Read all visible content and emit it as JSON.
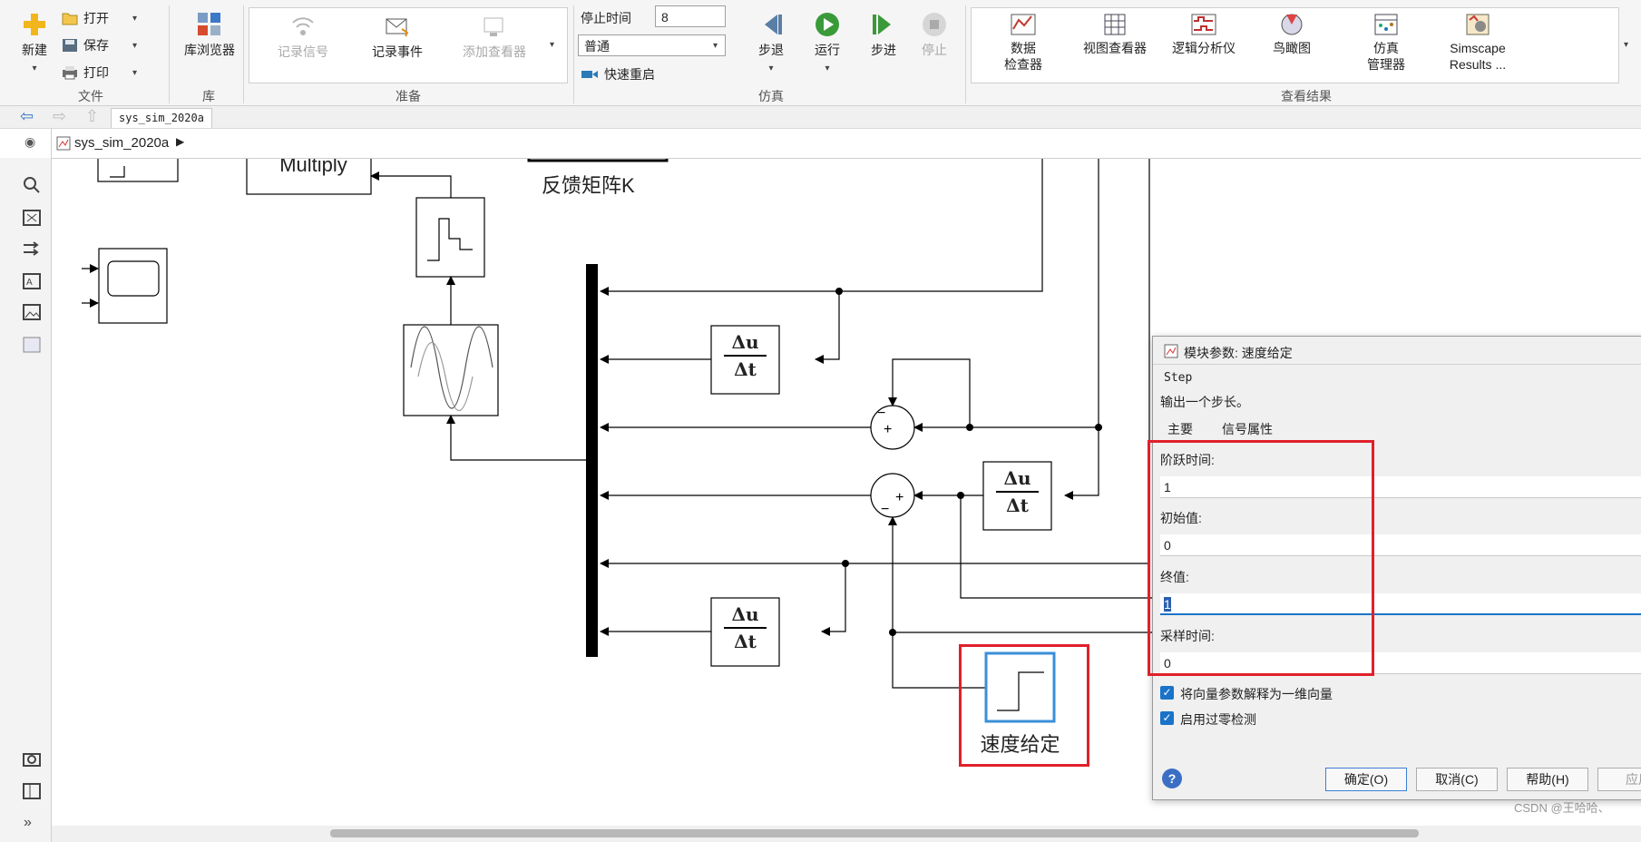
{
  "toolstrip": {
    "file": {
      "new_label": "新建",
      "open_label": "打开",
      "save_label": "保存",
      "print_label": "打印",
      "group_label": "文件"
    },
    "library": {
      "browser_label": "库浏览器",
      "group_label": "库"
    },
    "prepare": {
      "log_signal_label": "记录信号",
      "log_event_label": "记录事件",
      "add_viewer_label": "添加查看器",
      "group_label": "准备"
    },
    "simulate": {
      "stop_time_label": "停止时间",
      "stop_time_value": "8",
      "mode_value": "普通",
      "fast_restart_label": "快速重启",
      "step_back_label": "步退",
      "run_label": "运行",
      "step_forward_label": "步进",
      "stop_label": "停止",
      "group_label": "仿真"
    },
    "review": {
      "items": [
        {
          "line1": "数据",
          "line2": "检查器"
        },
        {
          "line1": "视图查看器",
          "line2": ""
        },
        {
          "line1": "逻辑分析仪",
          "line2": ""
        },
        {
          "line1": "鸟瞰图",
          "line2": ""
        },
        {
          "line1": "仿真",
          "line2": "管理器"
        },
        {
          "line1": "Simscape",
          "line2": "Results ..."
        }
      ],
      "group_label": "查看结果"
    }
  },
  "nav": {
    "tab_label": "sys_sim_2020a"
  },
  "address": {
    "model_name": "sys_sim_2020a"
  },
  "canvas": {
    "multiply_label": "Multiply",
    "feedback_label": "反馈矩阵K",
    "deriv_num": "Δu",
    "deriv_den": "Δt",
    "step_block_label": "速度给定"
  },
  "dialog": {
    "title": "模块参数: 速度给定",
    "block_type": "Step",
    "description": "输出一个步长。",
    "tab_main": "主要",
    "tab_signal": "信号属性",
    "fields": [
      {
        "label": "阶跃时间:",
        "value": "1"
      },
      {
        "label": "初始值:",
        "value": "0"
      },
      {
        "label": "终值:",
        "value": "1"
      },
      {
        "label": "采样时间:",
        "value": "0"
      }
    ],
    "checkbox1": "将向量参数解释为一维向量",
    "checkbox2": "启用过零检测",
    "ok_label": "确定(O)",
    "cancel_label": "取消(C)",
    "help_label": "帮助(H)",
    "apply_label": "应用"
  },
  "watermark": "CSDN @王哈哈、",
  "colors": {
    "highlight_red": "#e0202a",
    "accent_blue": "#1a73c8"
  }
}
